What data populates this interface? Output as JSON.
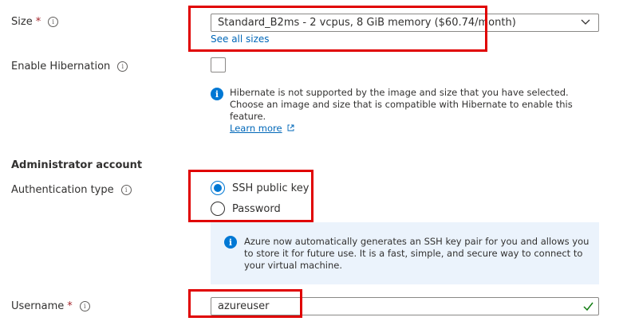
{
  "size": {
    "label": "Size",
    "required_mark": "*",
    "selected_value": "Standard_B2ms - 2 vcpus, 8 GiB memory ($60.74/month)",
    "see_all_link": "See all sizes"
  },
  "hibernation": {
    "label": "Enable Hibernation",
    "checked": false,
    "message": "Hibernate is not supported by the image and size that you have selected. Choose an image and size that is compatible with Hibernate to enable this feature.",
    "learn_more_link": "Learn more"
  },
  "admin": {
    "heading": "Administrator account",
    "auth_type_label": "Authentication type",
    "options": [
      "SSH public key",
      "Password"
    ],
    "selected_option": "SSH public key",
    "ssh_message": "Azure now automatically generates an SSH key pair for you and allows you to store it for future use. It is a fast, simple, and secure way to connect to your virtual machine."
  },
  "username": {
    "label": "Username",
    "required_mark": "*",
    "value": "azureuser"
  },
  "colors": {
    "accent": "#0078d4",
    "link": "#0067b8",
    "required": "#a4262c",
    "highlight_box": "#e00000",
    "valid_check": "#107c10",
    "info_background": "#ebf3fc"
  },
  "icons": {
    "info": "info-icon",
    "dropdown": "chevron-down-icon",
    "external_link": "external-link-icon",
    "valid": "checkmark-icon"
  }
}
